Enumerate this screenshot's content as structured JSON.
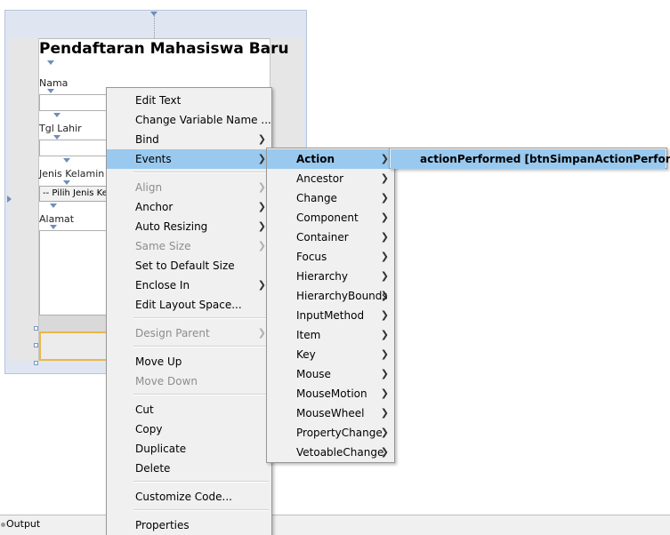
{
  "form": {
    "title": "Pendaftaran Mahasiswa Baru",
    "labels": {
      "nama": "Nama",
      "tgl_lahir": "Tgl Lahir",
      "jenis_kelamin": "Jenis Kelamin",
      "alamat": "Alamat"
    },
    "jenis_kelamin_combo": "-- Pilih Jenis Ke"
  },
  "context_menu": {
    "items": [
      {
        "label": "Edit Text",
        "submenu": false,
        "enabled": true
      },
      {
        "label": "Change Variable Name ...",
        "submenu": false,
        "enabled": true
      },
      {
        "label": "Bind",
        "submenu": true,
        "enabled": true
      },
      {
        "label": "Events",
        "submenu": true,
        "enabled": true,
        "highlighted": true
      },
      {
        "label": "Align",
        "submenu": true,
        "enabled": false
      },
      {
        "label": "Anchor",
        "submenu": true,
        "enabled": true
      },
      {
        "label": "Auto Resizing",
        "submenu": true,
        "enabled": true
      },
      {
        "label": "Same Size",
        "submenu": true,
        "enabled": false
      },
      {
        "label": "Set to Default Size",
        "submenu": false,
        "enabled": true
      },
      {
        "label": "Enclose In",
        "submenu": true,
        "enabled": true
      },
      {
        "label": "Edit Layout Space...",
        "submenu": false,
        "enabled": true
      },
      {
        "label": "Design Parent",
        "submenu": true,
        "enabled": false
      },
      {
        "label": "Move Up",
        "submenu": false,
        "enabled": true
      },
      {
        "label": "Move Down",
        "submenu": false,
        "enabled": false
      },
      {
        "label": "Cut",
        "submenu": false,
        "enabled": true
      },
      {
        "label": "Copy",
        "submenu": false,
        "enabled": true
      },
      {
        "label": "Duplicate",
        "submenu": false,
        "enabled": true
      },
      {
        "label": "Delete",
        "submenu": false,
        "enabled": true
      },
      {
        "label": "Customize Code...",
        "submenu": false,
        "enabled": true
      },
      {
        "label": "Properties",
        "submenu": false,
        "enabled": true
      }
    ]
  },
  "events_menu": {
    "items": [
      {
        "label": "Action",
        "highlighted": true
      },
      {
        "label": "Ancestor"
      },
      {
        "label": "Change"
      },
      {
        "label": "Component"
      },
      {
        "label": "Container"
      },
      {
        "label": "Focus"
      },
      {
        "label": "Hierarchy"
      },
      {
        "label": "HierarchyBounds"
      },
      {
        "label": "InputMethod"
      },
      {
        "label": "Item"
      },
      {
        "label": "Key"
      },
      {
        "label": "Mouse"
      },
      {
        "label": "MouseMotion"
      },
      {
        "label": "MouseWheel"
      },
      {
        "label": "PropertyChange"
      },
      {
        "label": "VetoableChange"
      }
    ]
  },
  "action_menu": {
    "item": "actionPerformed [btnSimpanActionPerformed]"
  },
  "status_bar": {
    "output_tab": "Output"
  },
  "icons": {
    "submenu_arrow": "chevron-right-icon",
    "anchor": "anchor-triangle-icon",
    "output": "output-icon"
  },
  "colors": {
    "menu_highlight": "#99c9ef",
    "menu_background": "#f0f0f0",
    "selection_border": "#e8b84a",
    "anchor_marker": "#6d8fb8"
  }
}
